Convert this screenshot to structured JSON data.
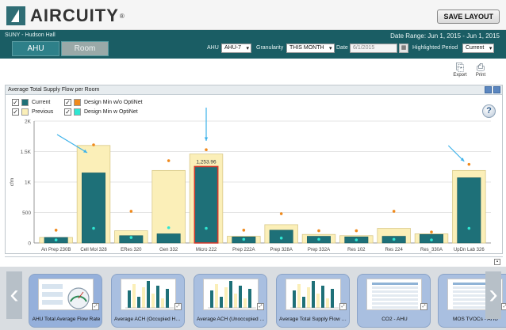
{
  "header": {
    "brand": "AIRCUITY",
    "trademark": "®",
    "save_layout": "SAVE LAYOUT"
  },
  "context": {
    "site": "SUNY - Hudson Hall",
    "date_range": "Date Range: Jun 1, 2015 - Jun 1, 2015"
  },
  "view_tabs": [
    {
      "label": "AHU",
      "active": true
    },
    {
      "label": "Room",
      "active": false
    }
  ],
  "controls": {
    "ahu_label": "AHU",
    "ahu_value": "AHU-7",
    "granularity_label": "Granularity",
    "granularity_value": "THIS MONTH",
    "date_label": "Date",
    "date_value": "6/1/2015",
    "period_label": "Highlighted Period",
    "period_value": "Current"
  },
  "toolbar": {
    "export_label": "Export",
    "print_label": "Print"
  },
  "panel": {
    "title": "Average Total Supply Flow per Room"
  },
  "legend": [
    {
      "label": "Current",
      "color": "#1e7078",
      "checked": true
    },
    {
      "label": "Design Min w/o OptiNet",
      "color": "#f08a1d",
      "checked": true
    },
    {
      "label": "Previous",
      "color": "#fbefb8",
      "checked": true
    },
    {
      "label": "Design Min w OptiNet",
      "color": "#2ee6d2",
      "checked": true
    }
  ],
  "chart_data": {
    "type": "bar",
    "title": "Average Total Supply Flow per Room",
    "ylabel": "cfm",
    "ylim": [
      0,
      2000
    ],
    "ytick_labels": [
      "0",
      "500",
      "1K",
      "1.5K",
      "2K"
    ],
    "ytick_values": [
      0,
      500,
      1000,
      1500,
      2000
    ],
    "grid": true,
    "legend_position": "top-left",
    "categories": [
      "An Prep 230B",
      "Cell Mol 328",
      "ERes 320",
      "Gen 332",
      "Micro 222",
      "Prep 222A",
      "Prep 328A",
      "Prep 332A",
      "Res 102",
      "Res 224",
      "Res_330A",
      "UpDn Lab 326"
    ],
    "series": [
      {
        "name": "Current",
        "values": [
          90,
          1150,
          120,
          150,
          1254,
          100,
          210,
          110,
          100,
          110,
          140,
          1070
        ]
      },
      {
        "name": "Previous",
        "values": [
          90,
          1600,
          200,
          1190,
          1460,
          110,
          300,
          140,
          120,
          240,
          150,
          1190
        ]
      },
      {
        "name": "Design Min w/o OptiNet",
        "values": [
          210,
          1610,
          520,
          1350,
          1530,
          210,
          480,
          200,
          200,
          520,
          180,
          1290
        ]
      },
      {
        "name": "Design Min w OptiNet",
        "values": [
          50,
          240,
          90,
          250,
          240,
          60,
          80,
          60,
          50,
          60,
          50,
          240
        ]
      }
    ],
    "highlighted": {
      "category": "Micro 222",
      "label": "1,253.96"
    },
    "annotation_arrows_on": [
      "Cell Mol 328",
      "Micro 222",
      "UpDn Lab 326"
    ],
    "colors": {
      "current": "#1e7078",
      "previous": "#fbefb8",
      "previous_border": "#d9c98a",
      "design_wo": "#f08a1d",
      "design_w": "#2ee6d2",
      "highlight": "#d33a2c",
      "arrow": "#3db2ea"
    }
  },
  "thumbnails": [
    {
      "label": "AHU Total Average Flow Rate",
      "kind": "gauge",
      "selected": true
    },
    {
      "label": "Average ACH (Occupied Hours)",
      "kind": "bars",
      "selected": false
    },
    {
      "label": "Average ACH (Unoccupied Hours)",
      "kind": "bars",
      "selected": false
    },
    {
      "label": "Average Total Supply Flow per Room",
      "kind": "bars",
      "selected": false
    },
    {
      "label": "CO2 - AHU",
      "kind": "table",
      "selected": false
    },
    {
      "label": "MOS TVOCs - AHU",
      "kind": "table",
      "selected": false
    }
  ]
}
